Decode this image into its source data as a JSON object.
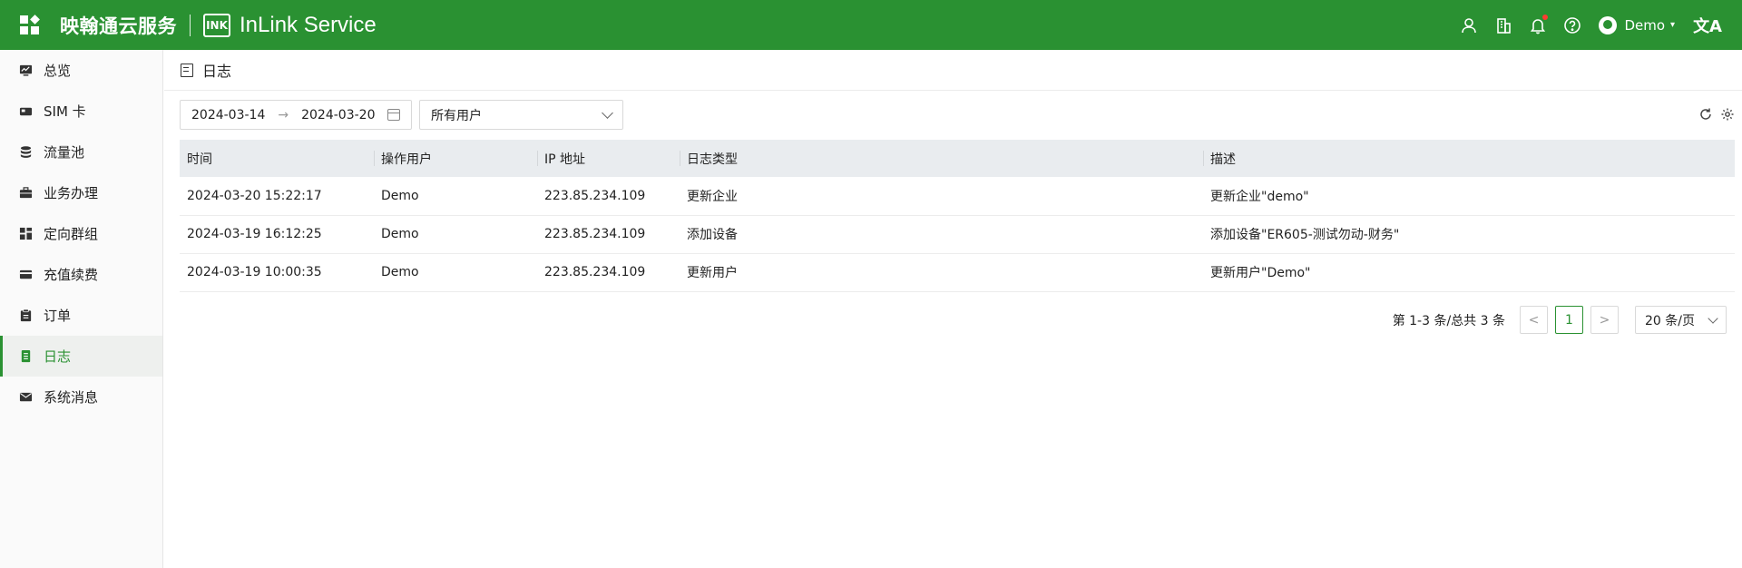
{
  "header": {
    "brand_cn": "映翰通云服务",
    "logo_mark": "INK",
    "brand_en": "InLink Service",
    "username": "Demo",
    "lang_glyph": "文A",
    "icons": [
      "user-settings-icon",
      "building-icon",
      "bell-icon",
      "help-icon",
      "avatar",
      "translate-icon"
    ],
    "notification_dot": true
  },
  "sidebar": {
    "items": [
      {
        "label": "总览",
        "icon": "dashboard-icon"
      },
      {
        "label": "SIM 卡",
        "icon": "sim-card-icon"
      },
      {
        "label": "流量池",
        "icon": "database-icon"
      },
      {
        "label": "业务办理",
        "icon": "briefcase-icon"
      },
      {
        "label": "定向群组",
        "icon": "group-icon"
      },
      {
        "label": "充值续费",
        "icon": "credit-card-icon"
      },
      {
        "label": "订单",
        "icon": "clipboard-icon"
      },
      {
        "label": "日志",
        "icon": "log-icon",
        "active": true
      },
      {
        "label": "系统消息",
        "icon": "mail-icon"
      }
    ]
  },
  "page": {
    "title": "日志"
  },
  "filters": {
    "start_date": "2024-03-14",
    "arrow": "→",
    "end_date": "2024-03-20",
    "user_select": "所有用户"
  },
  "table": {
    "columns": [
      "时间",
      "操作用户",
      "IP 地址",
      "日志类型",
      "描述"
    ],
    "rows": [
      [
        "2024-03-20 15:22:17",
        "Demo",
        "223.85.234.109",
        "更新企业",
        "更新企业\"demo\""
      ],
      [
        "2024-03-19 16:12:25",
        "Demo",
        "223.85.234.109",
        "添加设备",
        "添加设备\"ER605-测试勿动-财务\""
      ],
      [
        "2024-03-19 10:00:35",
        "Demo",
        "223.85.234.109",
        "更新用户",
        "更新用户\"Demo\""
      ]
    ]
  },
  "pagination": {
    "total_text": "第 1-3 条/总共 3 条",
    "prev": "<",
    "current_page": "1",
    "next": ">",
    "page_size": "20 条/页"
  },
  "colors": {
    "brand_green": "#2a9132",
    "header_bg": "#2a9132",
    "table_header_bg": "#e9ecef",
    "notification_red": "#ff3b30"
  }
}
